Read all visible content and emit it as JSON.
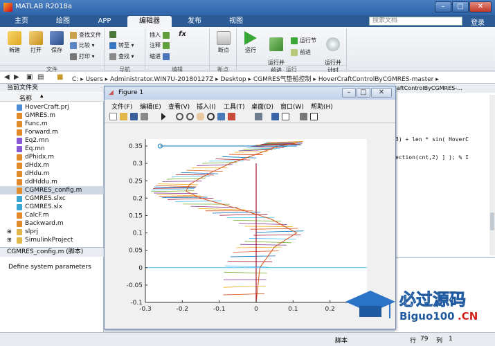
{
  "window": {
    "title": "MATLAB R2018a",
    "controls": [
      "–",
      "□",
      "✕"
    ]
  },
  "tabs": [
    {
      "label": "主页"
    },
    {
      "label": "绘图"
    },
    {
      "label": "APP"
    },
    {
      "label": "编辑器"
    },
    {
      "label": "发布"
    },
    {
      "label": "视图"
    }
  ],
  "search": {
    "placeholder": "搜索文档"
  },
  "login_label": "登录",
  "ribbon": {
    "file_group": {
      "new": "新建",
      "open": "打开",
      "save": "保存",
      "find_files": "查找文件",
      "compare": "比较",
      "print": "打印",
      "label": "文件"
    },
    "nav_group": {
      "goto": "转至",
      "find": "查找",
      "label": "导航"
    },
    "edit_group": {
      "insert": "插入",
      "fx": "fx",
      "comment": "注释",
      "indent": "缩进",
      "label": "编辑"
    },
    "breakpoint_group": {
      "breakpoints": "断点",
      "label": "断点"
    },
    "run_group": {
      "run": "运行",
      "run_advance": "运行并\n前进",
      "run_section": "运行节",
      "advance": "前进",
      "run_time": "运行并\n计时",
      "label": "运行"
    }
  },
  "address_bar": {
    "path": [
      "C:",
      "Users",
      "Administrator.WIN7U-20180127Z",
      "Desktop",
      "CGMRES气垫船控制",
      "HoverCraftControlByCGMRES-master"
    ]
  },
  "current_folder": {
    "header": "当前文件夹",
    "column": "名称",
    "files": [
      {
        "name": "HoverCraft.prj",
        "kind": "prj"
      },
      {
        "name": "GMRES.m",
        "kind": "m"
      },
      {
        "name": "Func.m",
        "kind": "m"
      },
      {
        "name": "Forward.m",
        "kind": "m"
      },
      {
        "name": "Eq2.mn",
        "kind": "mn"
      },
      {
        "name": "Eq.mn",
        "kind": "mn"
      },
      {
        "name": "dPhidx.m",
        "kind": "m"
      },
      {
        "name": "dHdx.m",
        "kind": "m"
      },
      {
        "name": "dHdu.m",
        "kind": "m"
      },
      {
        "name": "ddHddu.m",
        "kind": "m"
      },
      {
        "name": "CGMRES_config.m",
        "kind": "m",
        "selected": true
      },
      {
        "name": "CGMRES.slxc",
        "kind": "slx"
      },
      {
        "name": "CGMRES.slx",
        "kind": "slx"
      },
      {
        "name": "CalcF.m",
        "kind": "m"
      },
      {
        "name": "Backward.m",
        "kind": "m"
      },
      {
        "name": "slprj",
        "kind": "folder"
      },
      {
        "name": "SimulinkProject",
        "kind": "folder"
      }
    ],
    "details_title": "CGMRES_config.m (脚本)",
    "description": "Define system parameters"
  },
  "editor": {
    "tab_title": "aftControlByCGMRES-...",
    "lines": [
      "3) + len * sin( HoverC",
      "ection(cnt,2) ] ); % I"
    ]
  },
  "status_bar": {
    "mode": "脚本",
    "line_label": "行",
    "line": "79",
    "col_label": "列",
    "col": "1"
  },
  "figure": {
    "title": "Figure 1",
    "menu": [
      "文件(F)",
      "编辑(E)",
      "查看(V)",
      "插入(I)",
      "工具(T)",
      "桌面(D)",
      "窗口(W)",
      "帮助(H)"
    ],
    "controls": [
      "–",
      "□",
      "✕"
    ]
  },
  "chart_data": {
    "type": "line",
    "title": "",
    "xlabel": "",
    "ylabel": "",
    "xlim": [
      -0.3,
      0.3
    ],
    "ylim": [
      -0.1,
      0.37
    ],
    "xticks": [
      -0.3,
      -0.2,
      -0.1,
      0,
      0.1,
      0.2
    ],
    "yticks": [
      -0.1,
      -0.05,
      0,
      0.05,
      0.1,
      0.15,
      0.2,
      0.25,
      0.3,
      0.35
    ],
    "grid": false,
    "trajectory": {
      "x": [
        0.0,
        0.01,
        0.05,
        0.11,
        0.04,
        -0.05,
        -0.15,
        -0.19,
        -0.18,
        -0.13,
        -0.07,
        0.01,
        0.06,
        0.09,
        0.11,
        0.1
      ],
      "y": [
        -0.1,
        0.0,
        0.06,
        0.1,
        0.14,
        0.17,
        0.2,
        0.22,
        0.24,
        0.27,
        0.3,
        0.33,
        0.35,
        0.355,
        0.36,
        0.355
      ]
    },
    "reference_line_x": 0.0,
    "horizontal_line_y": 0.0,
    "start_marker": {
      "x": -0.26,
      "y": 0.35
    },
    "hover_lines": {
      "count": 70,
      "colors": [
        "#0072bd",
        "#d95319",
        "#edb120",
        "#7e2f8e",
        "#77ac30",
        "#4dbeee",
        "#a2142f"
      ]
    }
  },
  "watermark": {
    "text_cn": "必过源码",
    "text_en": "Biguo100",
    "suffix": ".CN"
  }
}
